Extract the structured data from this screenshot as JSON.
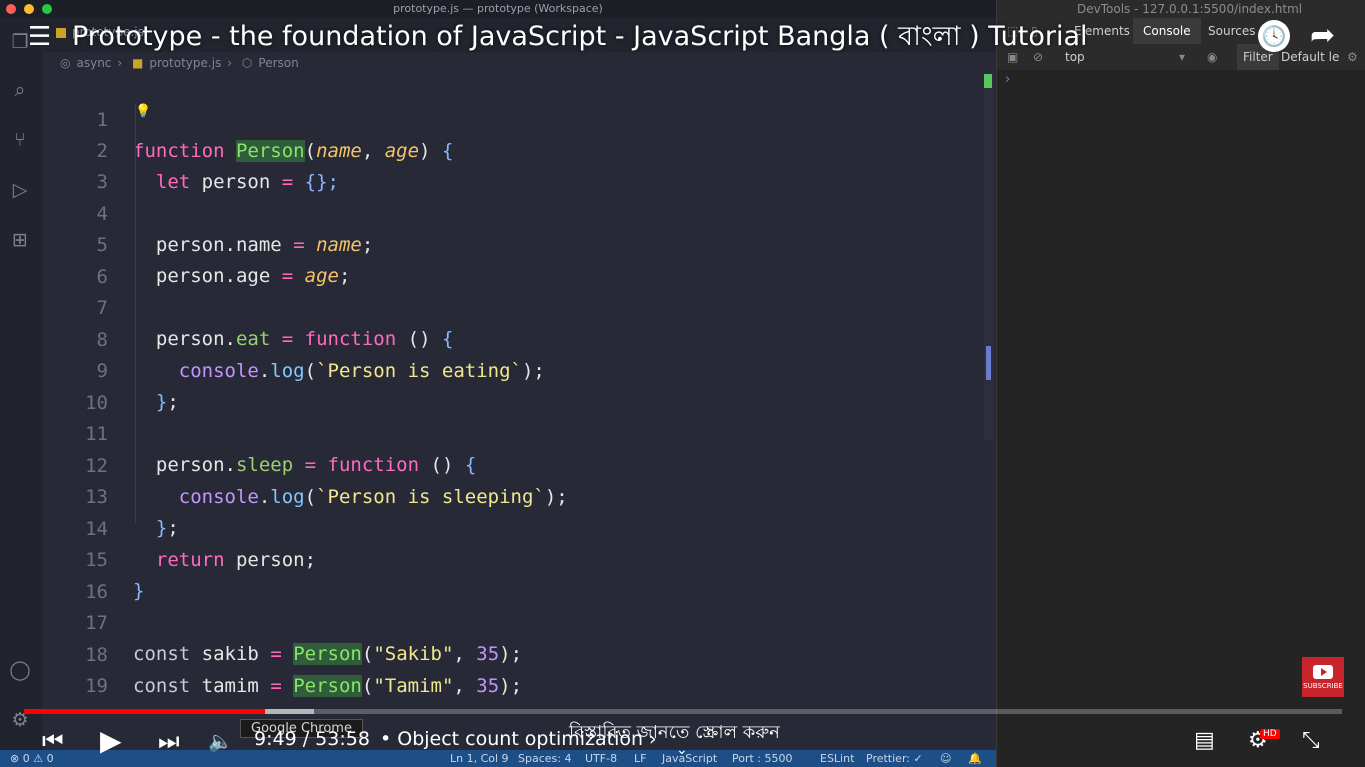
{
  "editor": {
    "window_title": "prototype.js — prototype (Workspace)",
    "tab_label": "prototype.js",
    "breadcrumb": [
      "async",
      "prototype.js",
      "Person"
    ],
    "code_lines": [
      {
        "n": "1"
      },
      {
        "n": "2"
      },
      {
        "n": "3"
      },
      {
        "n": "4"
      },
      {
        "n": "5"
      },
      {
        "n": "6"
      },
      {
        "n": "7"
      },
      {
        "n": "8"
      },
      {
        "n": "9"
      },
      {
        "n": "10"
      },
      {
        "n": "11"
      },
      {
        "n": "12"
      },
      {
        "n": "13"
      },
      {
        "n": "14"
      },
      {
        "n": "15"
      },
      {
        "n": "16"
      },
      {
        "n": "17"
      },
      {
        "n": "18"
      },
      {
        "n": "19"
      }
    ],
    "tokens": {
      "kw_function": "function",
      "fn_person": "Person",
      "p_name": "name",
      "p_age": "age",
      "kw_let": "let",
      "v_person": "person",
      "empty_obj": "{};",
      "m_name": "name",
      "m_age": "age",
      "m_eat": "eat",
      "m_sleep": "sleep",
      "console": "console",
      "log": "log",
      "str_eating": "`Person is eating`",
      "str_sleeping": "`Person is sleeping`",
      "kw_return": "return",
      "kw_const": "const",
      "v_sakib": "sakib",
      "v_tamim": "tamim",
      "str_sakib": "\"Sakib\"",
      "str_tamim": "\"Tamim\"",
      "num_35": "35"
    }
  },
  "status_bar": {
    "problems": "⊗ 0 ⚠ 0",
    "position": "Ln 1, Col 9",
    "spaces": "Spaces: 4",
    "encoding": "UTF-8",
    "eol": "LF",
    "language": "JavaScript",
    "port": "Port : 5500",
    "eslint": "ESLint",
    "prettier": "Prettier: ✓"
  },
  "devtools": {
    "title": "DevTools - 127.0.0.1:5500/index.html",
    "tabs": [
      "Elements",
      "Console",
      "Sources"
    ],
    "active_tab": "Console",
    "context": "top",
    "filter_placeholder": "Filter",
    "levels": "Default le",
    "prompt": "›"
  },
  "video": {
    "title": "Prototype - the foundation of JavaScript - JavaScript Bangla ( বাংলা ) Tutorial",
    "time": "9:49 / 53:58",
    "chapter": "• Object count optimization ›",
    "scroll_hint": "বিস্তারিত জানতে স্ক্রোল করুন",
    "tooltip": "Google Chrome",
    "subscribe_label": "SUBSCRIBE",
    "hd_badge": "HD",
    "progress_played": 0.183,
    "progress_buffered": 0.22,
    "colors": {
      "played": "#ff0000",
      "accent": "#c8242b"
    }
  }
}
